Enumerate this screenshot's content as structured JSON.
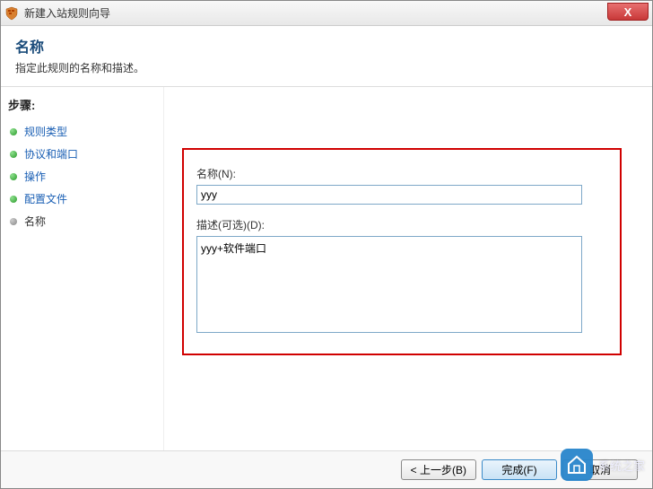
{
  "window": {
    "title": "新建入站规则向导",
    "close_label": "X"
  },
  "header": {
    "title": "名称",
    "subtitle": "指定此规则的名称和描述。"
  },
  "sidebar": {
    "title": "步骤:",
    "items": [
      {
        "label": "规则类型",
        "current": false
      },
      {
        "label": "协议和端口",
        "current": false
      },
      {
        "label": "操作",
        "current": false
      },
      {
        "label": "配置文件",
        "current": false
      },
      {
        "label": "名称",
        "current": true
      }
    ]
  },
  "form": {
    "name_label": "名称(N):",
    "name_value": "yyy",
    "desc_label": "描述(可选)(D):",
    "desc_value": "yyy+软件端口"
  },
  "footer": {
    "back": "< 上一步(B)",
    "finish": "完成(F)",
    "cancel": "取消"
  },
  "watermark": {
    "text": "系统之家"
  }
}
